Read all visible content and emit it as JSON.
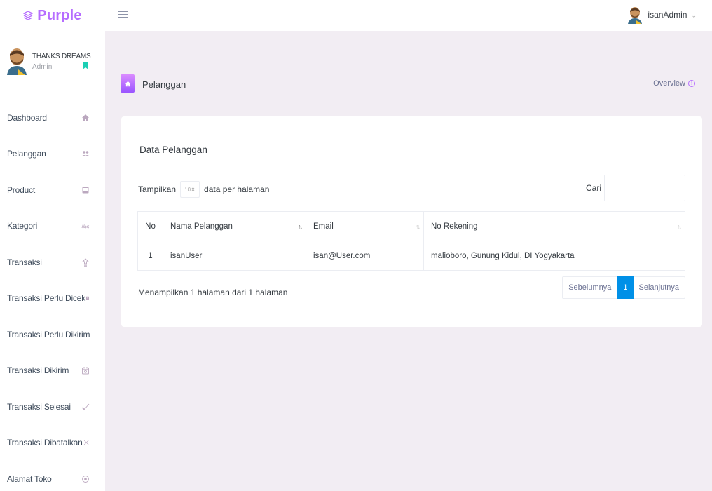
{
  "brand": {
    "name": "Purple"
  },
  "topbar": {
    "username": "isanAdmin",
    "caret": "⌄"
  },
  "sidebar": {
    "profile": {
      "name": "THANKS DREAMS",
      "role": "Admin"
    },
    "items": [
      {
        "label": "Dashboard",
        "icon": "home-icon"
      },
      {
        "label": "Pelanggan",
        "icon": "users-icon"
      },
      {
        "label": "Product",
        "icon": "box-icon"
      },
      {
        "label": "Kategori",
        "icon": "abc-icon"
      },
      {
        "label": "Transaksi",
        "icon": "upload-icon"
      },
      {
        "label": "Transaksi Perlu Dicek",
        "icon": "book-icon"
      },
      {
        "label": "Transaksi Perlu Dikirim",
        "icon": "upload-icon"
      },
      {
        "label": "Transaksi Dikirim",
        "icon": "calendar-icon"
      },
      {
        "label": "Transaksi Selesai",
        "icon": "check-icon"
      },
      {
        "label": "Transaksi Dibatalkan",
        "icon": "close-icon"
      },
      {
        "label": "Alamat Toko",
        "icon": "target-icon"
      }
    ]
  },
  "page": {
    "title": "Pelanggan",
    "overview": "Overview"
  },
  "card": {
    "title": "Data Pelanggan",
    "length_prefix": "Tampilkan",
    "length_value": "10",
    "length_suffix": "data per halaman",
    "search_label": "Cari",
    "search_value": "",
    "columns": [
      "No",
      "Nama Pelanggan",
      "Email",
      "No Rekening"
    ],
    "rows": [
      {
        "no": "1",
        "name": "isanUser",
        "email": "isan@User.com",
        "rekening": "malioboro, Gunung Kidul, DI Yogyakarta"
      }
    ],
    "info": "Menampilkan 1 halaman dari 1 halaman",
    "pagination": {
      "prev": "Sebelumnya",
      "current": "1",
      "next": "Selanjutnya"
    }
  },
  "colors": {
    "brand": "#b66dff",
    "page_active": "#0090e7",
    "background": "#f2edf3"
  }
}
